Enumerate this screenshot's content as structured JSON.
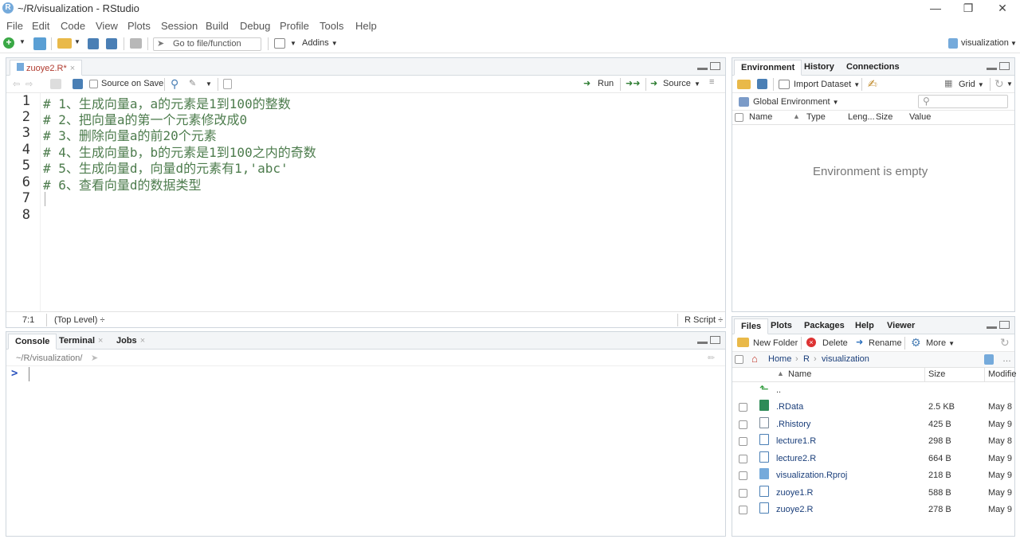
{
  "window": {
    "title": "~/R/visualization - RStudio",
    "logo": "R"
  },
  "menu": [
    "File",
    "Edit",
    "Code",
    "View",
    "Plots",
    "Session",
    "Build",
    "Debug",
    "Profile",
    "Tools",
    "Help"
  ],
  "toolbar": {
    "goto_file": "Go to file/function",
    "addins": "Addins",
    "project": "visualization"
  },
  "editor": {
    "tab": "zuoye2.R*",
    "source_on_save": "Source on Save",
    "run": "Run",
    "source": "Source",
    "lines": [
      "# 1、生成向量a，a的元素是1到100的整数",
      "# 2、把向量a的第一个元素修改成0",
      "# 3、删除向量a的前20个元素",
      "# 4、生成向量b，b的元素是1到100之内的奇数",
      "# 5、生成向量d，向量d的元素有1,'abc'",
      "# 6、查看向量d的数据类型",
      "",
      ""
    ],
    "line_numbers": [
      "1",
      "2",
      "3",
      "4",
      "5",
      "6",
      "7",
      "8"
    ],
    "status_position": "7:1",
    "status_scope": "(Top Level) ÷",
    "status_type": "R Script ÷"
  },
  "console": {
    "tabs": [
      "Console",
      "Terminal",
      "Jobs"
    ],
    "path": "~/R/visualization/",
    "prompt": ">"
  },
  "environment": {
    "tabs": [
      "Environment",
      "History",
      "Connections"
    ],
    "import_dataset": "Import Dataset",
    "grid": "Grid",
    "global_env": "Global Environment",
    "columns": [
      "Name",
      "Type",
      "Leng...",
      "Size",
      "Value"
    ],
    "empty_message": "Environment is empty"
  },
  "files": {
    "tabs": [
      "Files",
      "Plots",
      "Packages",
      "Help",
      "Viewer"
    ],
    "new_folder": "New Folder",
    "delete": "Delete",
    "rename": "Rename",
    "more": "More",
    "breadcrumb": [
      "Home",
      "R",
      "visualization"
    ],
    "columns": {
      "name": "Name",
      "size": "Size",
      "modified": "Modifie"
    },
    "up": "..",
    "rows": [
      {
        "name": ".RData",
        "size": "2.5 KB",
        "modified": "May 8",
        "icon": "rdata-icon"
      },
      {
        "name": ".Rhistory",
        "size": "425 B",
        "modified": "May 9",
        "icon": "text-file-icon"
      },
      {
        "name": "lecture1.R",
        "size": "298 B",
        "modified": "May 8",
        "icon": "r-script-icon"
      },
      {
        "name": "lecture2.R",
        "size": "664 B",
        "modified": "May 9",
        "icon": "r-script-icon"
      },
      {
        "name": "visualization.Rproj",
        "size": "218 B",
        "modified": "May 9",
        "icon": "rproj-icon"
      },
      {
        "name": "zuoye1.R",
        "size": "588 B",
        "modified": "May 9",
        "icon": "r-script-icon"
      },
      {
        "name": "zuoye2.R",
        "size": "278 B",
        "modified": "May 9",
        "icon": "r-script-icon"
      }
    ]
  },
  "colors": {
    "accent": "#75aadb",
    "comment": "#4d7c4d",
    "link": "#1a3e7a"
  }
}
